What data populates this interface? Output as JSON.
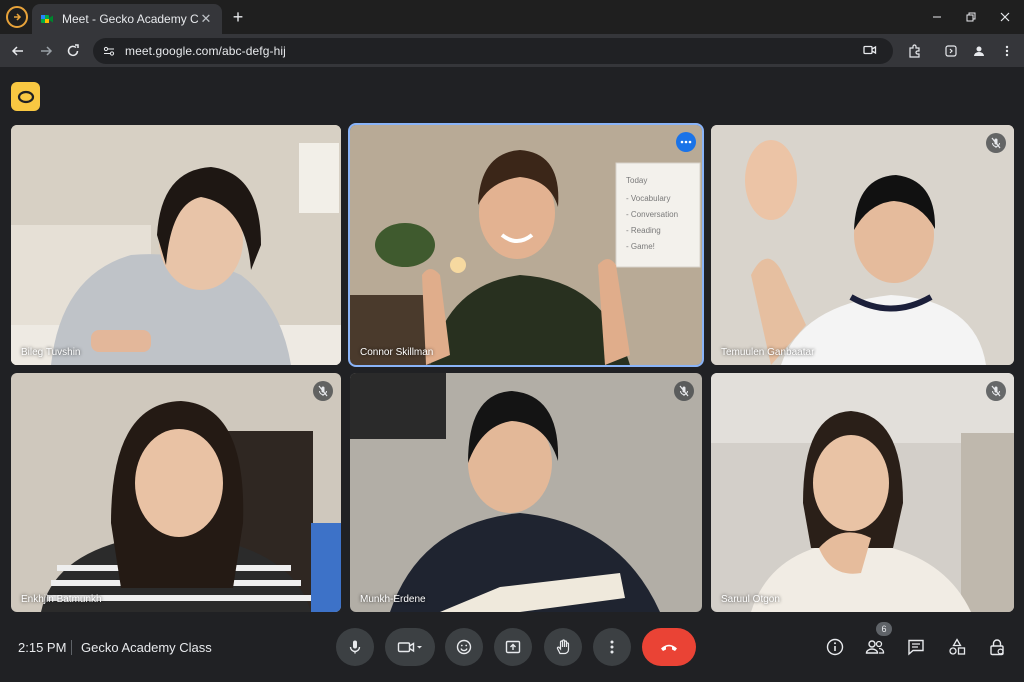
{
  "browser": {
    "tab_title": "Meet - Gecko Academy Class",
    "url": "meet.google.com/abc-defg-hij",
    "tab_close": "✕",
    "new_tab": "+"
  },
  "meeting": {
    "time": "2:15 PM",
    "title": "Gecko Academy Class",
    "participant_count": "6"
  },
  "participants": [
    {
      "name": "Bileg Tuvshin",
      "muted": false,
      "active": false
    },
    {
      "name": "Connor Skillman",
      "muted": false,
      "active": true
    },
    {
      "name": "Temuulen Ganbaatar",
      "muted": true,
      "active": false
    },
    {
      "name": "Enkhjin Batmunkh",
      "muted": true,
      "active": false
    },
    {
      "name": "Munkh-Erdene",
      "muted": true,
      "active": false
    },
    {
      "name": "Saruul Otgon",
      "muted": true,
      "active": false
    }
  ],
  "whiteboard": {
    "lines": [
      "Today",
      "- Vocabulary",
      "- Conversation",
      "- Reading",
      "- Game!"
    ]
  },
  "colors": {
    "accent": "#8ab4f8",
    "end_call": "#ea4335",
    "meet_logo": "#f9c842",
    "background": "#202124"
  },
  "icons": {
    "mic": "mic-icon",
    "camera": "camera-icon",
    "emoji": "emoji-icon",
    "present": "present-icon",
    "hand": "raise-hand-icon",
    "more": "more-vert-icon",
    "end": "end-call-icon",
    "info": "info-icon",
    "people": "people-icon",
    "chat": "chat-icon",
    "activities": "activities-icon",
    "lock": "host-controls-icon"
  }
}
